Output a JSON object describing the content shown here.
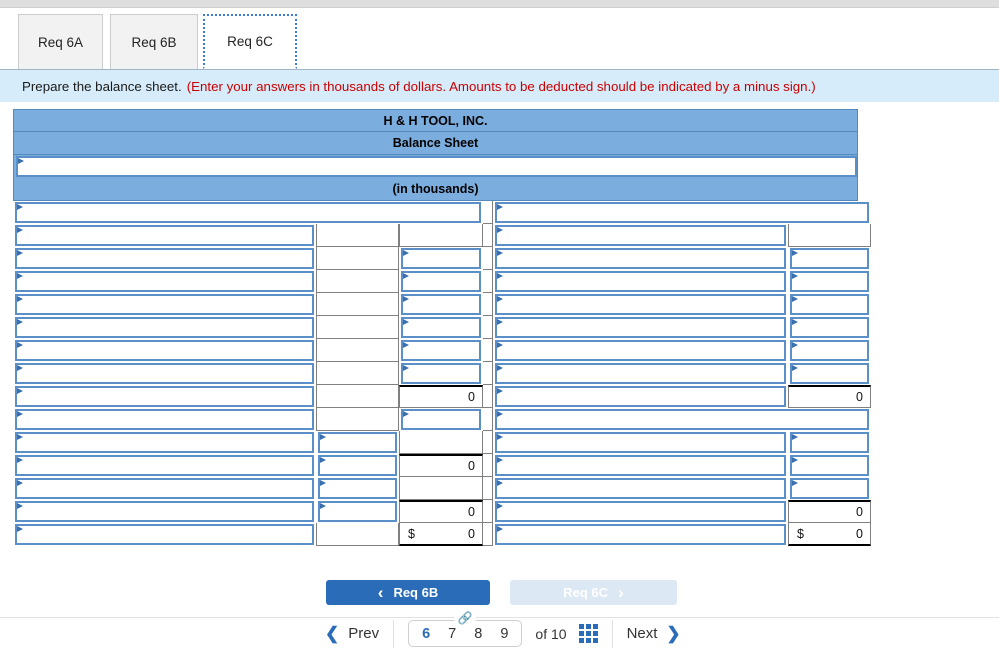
{
  "tabs": [
    {
      "label": "Req 6A",
      "active": false
    },
    {
      "label": "Req 6B",
      "active": false
    },
    {
      "label": "Req 6C",
      "active": true
    }
  ],
  "instruction": {
    "main": "Prepare the balance sheet.",
    "note": "(Enter your answers in thousands of dollars. Amounts to be deducted should be indicated by a minus sign.)"
  },
  "sheet": {
    "company": "H & H TOOL, INC.",
    "statement": "Balance Sheet",
    "date_value": "",
    "units": "(in thousands)",
    "left_column": {
      "rows": [
        {
          "label": "",
          "sub": "",
          "amount": "",
          "kind": "wide-entry"
        },
        {
          "label": "",
          "sub": "",
          "amount": "",
          "kind": "entry-plain-plain"
        },
        {
          "label": "",
          "sub": "",
          "amount": "",
          "kind": "entry-plain-entry"
        },
        {
          "label": "",
          "sub": "",
          "amount": "",
          "kind": "entry-plain-entry"
        },
        {
          "label": "",
          "sub": "",
          "amount": "",
          "kind": "entry-plain-entry"
        },
        {
          "label": "",
          "sub": "",
          "amount": "",
          "kind": "entry-plain-entry"
        },
        {
          "label": "",
          "sub": "",
          "amount": "",
          "kind": "entry-plain-entry"
        },
        {
          "label": "",
          "sub": "",
          "amount": "",
          "kind": "entry-plain-entry"
        },
        {
          "label": "",
          "sub": "",
          "amount": "0",
          "kind": "entry-plain-total"
        },
        {
          "label": "",
          "sub": "",
          "amount": "",
          "kind": "entry-plain-entry"
        },
        {
          "label": "",
          "sub": "",
          "amount": "",
          "kind": "entry-entry-plain"
        },
        {
          "label": "",
          "sub": "",
          "amount": "0",
          "kind": "entry-entry-total"
        },
        {
          "label": "",
          "sub": "",
          "amount": "",
          "kind": "entry-entry-plain"
        },
        {
          "label": "",
          "sub": "",
          "amount": "0",
          "kind": "entry-entry-total"
        },
        {
          "label": "",
          "sub": "",
          "amount": "0",
          "kind": "entry-plain-grand",
          "dollar": "$"
        }
      ]
    },
    "right_column": {
      "rows": [
        {
          "label": "",
          "amount": "",
          "kind": "wide-entry"
        },
        {
          "label": "",
          "amount": "",
          "kind": "entry-plain"
        },
        {
          "label": "",
          "amount": "",
          "kind": "entry-entry"
        },
        {
          "label": "",
          "amount": "",
          "kind": "entry-entry"
        },
        {
          "label": "",
          "amount": "",
          "kind": "entry-entry"
        },
        {
          "label": "",
          "amount": "",
          "kind": "entry-entry"
        },
        {
          "label": "",
          "amount": "",
          "kind": "entry-entry"
        },
        {
          "label": "",
          "amount": "",
          "kind": "entry-entry"
        },
        {
          "label": "",
          "amount": "0",
          "kind": "entry-total"
        },
        {
          "label": "",
          "amount": "",
          "kind": "wide-entry2"
        },
        {
          "label": "",
          "amount": "",
          "kind": "entry-entry"
        },
        {
          "label": "",
          "amount": "",
          "kind": "entry-entry"
        },
        {
          "label": "",
          "amount": "",
          "kind": "entry-entry"
        },
        {
          "label": "",
          "amount": "0",
          "kind": "entry-total"
        },
        {
          "label": "",
          "amount": "0",
          "kind": "entry-grand",
          "dollar": "$"
        }
      ]
    }
  },
  "req_nav": {
    "prev_button": "Req 6B",
    "next_button": "Req 6C",
    "prev_chevron": "chevron-left-icon",
    "next_chevron": "chevron-right-icon"
  },
  "pagination": {
    "prev_label": "Prev",
    "next_label": "Next",
    "pages": [
      {
        "num": "6",
        "active": true
      },
      {
        "num": "7",
        "active": false
      },
      {
        "num": "8",
        "active": false
      },
      {
        "num": "9",
        "active": false
      }
    ],
    "of_label": "of",
    "total": "10",
    "link_icon": "link-chain-icon",
    "grid_icon": "grid-view-icon"
  },
  "colors": {
    "header_blue": "#7BAEDE",
    "instruction_band": "#d7ecfa",
    "instruction_red": "#cc0000",
    "primary_button": "#2b6cb8",
    "disabled_button": "#dde8f5",
    "entry_border": "#5b8fc7"
  }
}
